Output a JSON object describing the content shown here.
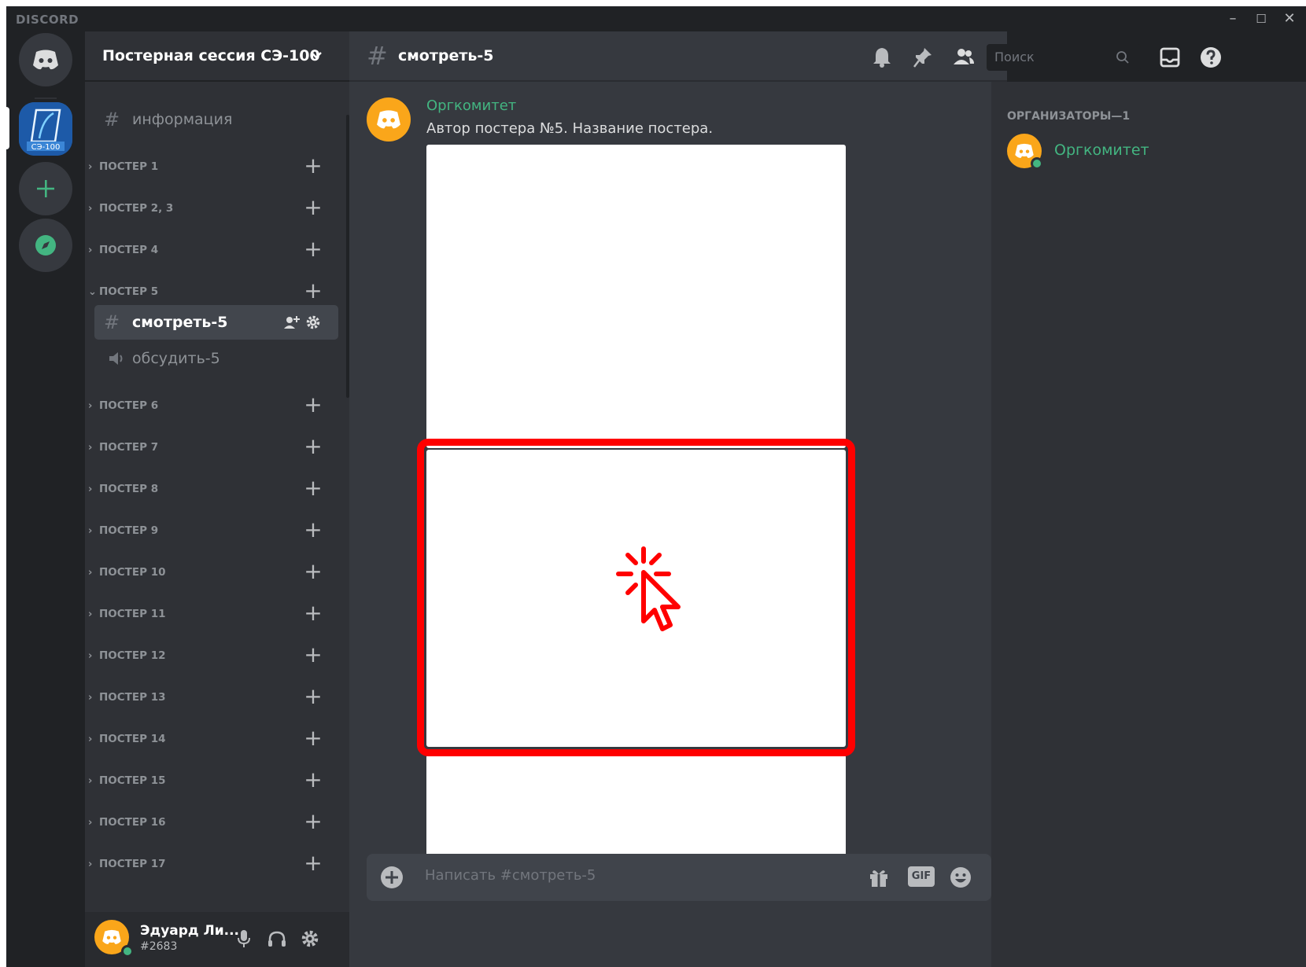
{
  "app": {
    "brand": "DISCORD"
  },
  "window_controls": {
    "minimize": "–",
    "maximize": "☐",
    "close": "✕"
  },
  "servers": [
    {
      "name": "home",
      "icon": "discord-logo-icon"
    },
    {
      "name": "СЭ-100",
      "label": "СЭ-100",
      "selected": true
    },
    {
      "name": "add-server",
      "icon": "plus-icon"
    },
    {
      "name": "explore",
      "icon": "compass-icon"
    }
  ],
  "guild": {
    "name": "Постерная сессия СЭ-100"
  },
  "sidebar": {
    "top_channel": "информация",
    "categories": [
      {
        "label": "ПОСТЕР 1",
        "expanded": false
      },
      {
        "label": "ПОСТЕР 2, 3",
        "expanded": false
      },
      {
        "label": "ПОСТЕР 4",
        "expanded": false
      },
      {
        "label": "ПОСТЕР 5",
        "expanded": true
      },
      {
        "label": "ПОСТЕР 6",
        "expanded": false
      },
      {
        "label": "ПОСТЕР 7",
        "expanded": false
      },
      {
        "label": "ПОСТЕР 8",
        "expanded": false
      },
      {
        "label": "ПОСТЕР 9",
        "expanded": false
      },
      {
        "label": "ПОСТЕР 10",
        "expanded": false
      },
      {
        "label": "ПОСТЕР 11",
        "expanded": false
      },
      {
        "label": "ПОСТЕР 12",
        "expanded": false
      },
      {
        "label": "ПОСТЕР 13",
        "expanded": false
      },
      {
        "label": "ПОСТЕР 14",
        "expanded": false
      },
      {
        "label": "ПОСТЕР 15",
        "expanded": false
      },
      {
        "label": "ПОСТЕР 16",
        "expanded": false
      },
      {
        "label": "ПОСТЕР 17",
        "expanded": false
      }
    ],
    "poster5_channels": [
      {
        "name": "смотреть-5",
        "type": "text",
        "selected": true
      },
      {
        "name": "обсудить-5",
        "type": "voice",
        "selected": false
      }
    ]
  },
  "user": {
    "name": "Эдуард Ли...",
    "tag": "#2683",
    "status": "online"
  },
  "chat": {
    "channel": "смотреть-5",
    "search_placeholder": "Поиск",
    "message": {
      "author": "Оргкомитет",
      "text": "Автор постера №5. Название постера."
    },
    "composer_placeholder": "Написать #смотреть-5",
    "gif_label": "GIF"
  },
  "members": {
    "group_title": "ОРГАНИЗАТОРЫ—1",
    "list": [
      {
        "name": "Оргкомитет",
        "status": "online"
      }
    ]
  },
  "colors": {
    "accent_green": "#43b581",
    "highlight_red": "#ff0000",
    "avatar_orange": "#faa61a",
    "blurple": "#7289da"
  }
}
